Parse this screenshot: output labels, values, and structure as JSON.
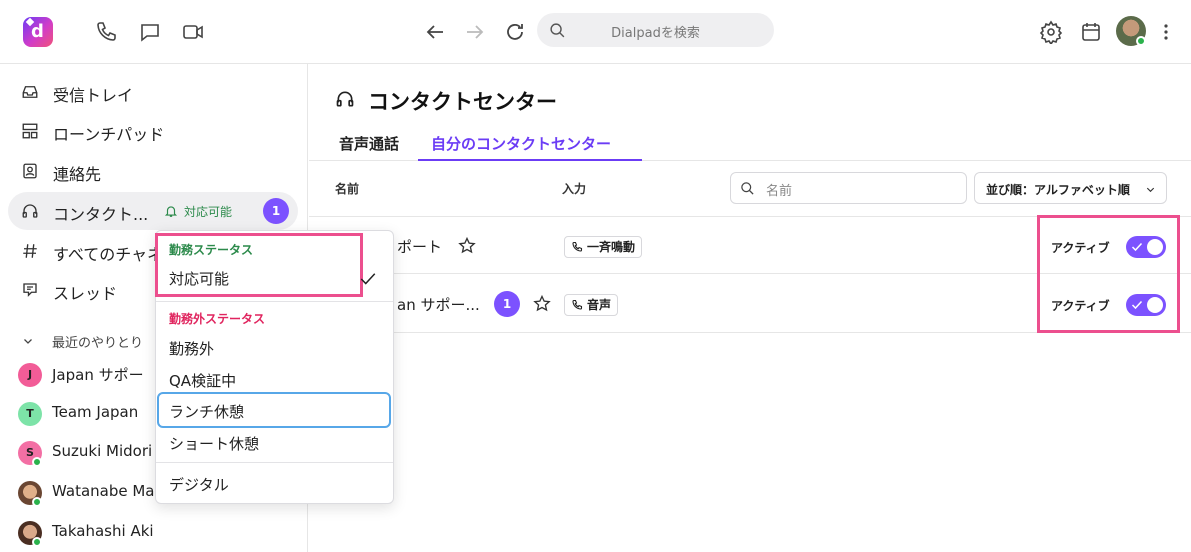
{
  "topbar": {
    "logo_letter": "d",
    "search_placeholder": "Dialpadを検索"
  },
  "sidebar": {
    "items": [
      {
        "label": "受信トレイ",
        "icon": "inbox-icon"
      },
      {
        "label": "ローンチパッド",
        "icon": "launchpad-icon"
      },
      {
        "label": "連絡先",
        "icon": "contacts-icon"
      },
      {
        "label": "コンタクト...",
        "icon": "headset-icon",
        "status": "対応可能",
        "badge": "1"
      },
      {
        "label": "すべてのチャネ",
        "icon": "hash-icon"
      },
      {
        "label": "スレッド",
        "icon": "threads-icon"
      }
    ],
    "recent_header": "最近のやりとり",
    "recent": [
      {
        "initial": "J",
        "name": "Japan サポー",
        "color": "#f25c97"
      },
      {
        "initial": "T",
        "name": "Team Japan",
        "color": "#7de3a8"
      },
      {
        "initial": "S",
        "name": "Suzuki Midori",
        "color": "#f36fa4"
      },
      {
        "initial": "",
        "name": "Watanabe Ma",
        "color": "#8b5a3c"
      },
      {
        "initial": "",
        "name": "Takahashi Aki",
        "color": "#6b4a3a"
      }
    ]
  },
  "main": {
    "title": "コンタクトセンター",
    "tabs": [
      {
        "label": "音声通話",
        "active": false
      },
      {
        "label": "自分のコンタクトセンター",
        "active": true
      }
    ],
    "columns": {
      "name": "名前",
      "input": "入力"
    },
    "search_placeholder": "名前",
    "sort_label": "並び順：アルファベット順",
    "rows": [
      {
        "name": "ポート",
        "badge": "",
        "channel": "一斉鳴動",
        "status": "アクティブ",
        "active": true
      },
      {
        "name": "an サポー...",
        "badge": "1",
        "channel": "音声",
        "status": "アクティブ",
        "active": true
      }
    ]
  },
  "dropdown": {
    "work_header": "勤務ステータス",
    "work_items": [
      "対応可能"
    ],
    "off_header": "勤務外ステータス",
    "off_items": [
      "勤務外",
      "QA検証中",
      "ランチ休憩",
      "ショート休憩"
    ],
    "extra_items": [
      "デジタル"
    ],
    "colors": {
      "work_header": "#2c8a4b",
      "off_header": "#e0245e"
    }
  },
  "colors": {
    "accent": "#7c52ff",
    "highlight": "#ec4f8e",
    "focus": "#57a7e8"
  }
}
